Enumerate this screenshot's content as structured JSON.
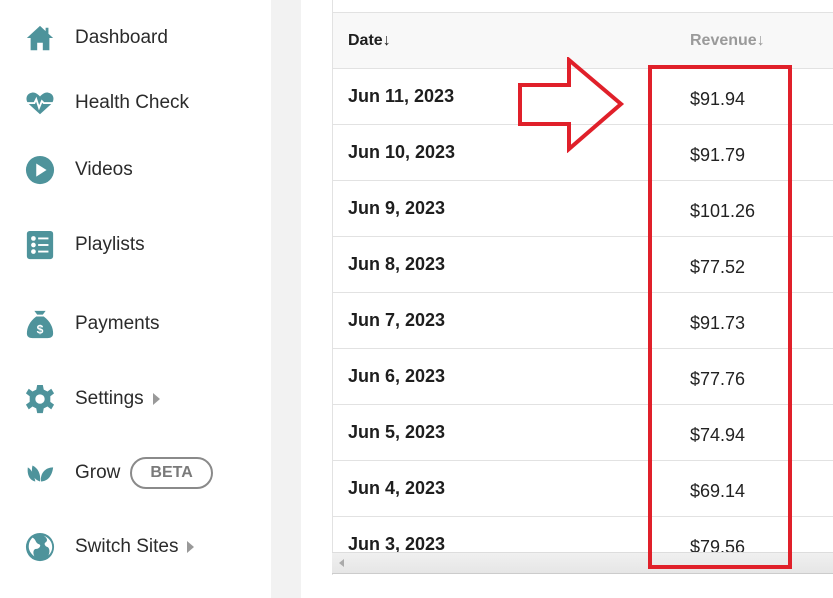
{
  "sidebar": {
    "items": [
      {
        "label": "Dashboard",
        "icon": "home-icon"
      },
      {
        "label": "Health Check",
        "icon": "heart-pulse-icon"
      },
      {
        "label": "Videos",
        "icon": "play-circle-icon"
      },
      {
        "label": "Playlists",
        "icon": "list-icon"
      },
      {
        "label": "Payments",
        "icon": "money-bag-icon"
      },
      {
        "label": "Settings",
        "icon": "gear-icon",
        "has_submenu": true
      },
      {
        "label": "Grow",
        "icon": "leaves-icon",
        "badge": "BETA"
      },
      {
        "label": "Switch Sites",
        "icon": "globe-icon",
        "has_submenu": true
      }
    ]
  },
  "table": {
    "columns": [
      {
        "label": "Date",
        "sort": "desc"
      },
      {
        "label": "Revenue",
        "sort": "desc"
      }
    ],
    "sort_arrow": "↓",
    "rows": [
      {
        "date": "Jun 11, 2023",
        "revenue": "$91.94"
      },
      {
        "date": "Jun 10, 2023",
        "revenue": "$91.79"
      },
      {
        "date": "Jun 9, 2023",
        "revenue": "$101.26"
      },
      {
        "date": "Jun 8, 2023",
        "revenue": "$77.52"
      },
      {
        "date": "Jun 7, 2023",
        "revenue": "$91.73"
      },
      {
        "date": "Jun 6, 2023",
        "revenue": "$77.76"
      },
      {
        "date": "Jun 5, 2023",
        "revenue": "$74.94"
      },
      {
        "date": "Jun 4, 2023",
        "revenue": "$69.14"
      },
      {
        "date": "Jun 3, 2023",
        "revenue": "$79.56"
      }
    ]
  },
  "annotation": {
    "color": "#e0202a",
    "arrow_direction": "right",
    "highlights": "revenue-column"
  },
  "colors": {
    "icon_teal": "#4e939b",
    "text_dark": "#2b2b2b",
    "header_muted": "#9a9a9a"
  }
}
